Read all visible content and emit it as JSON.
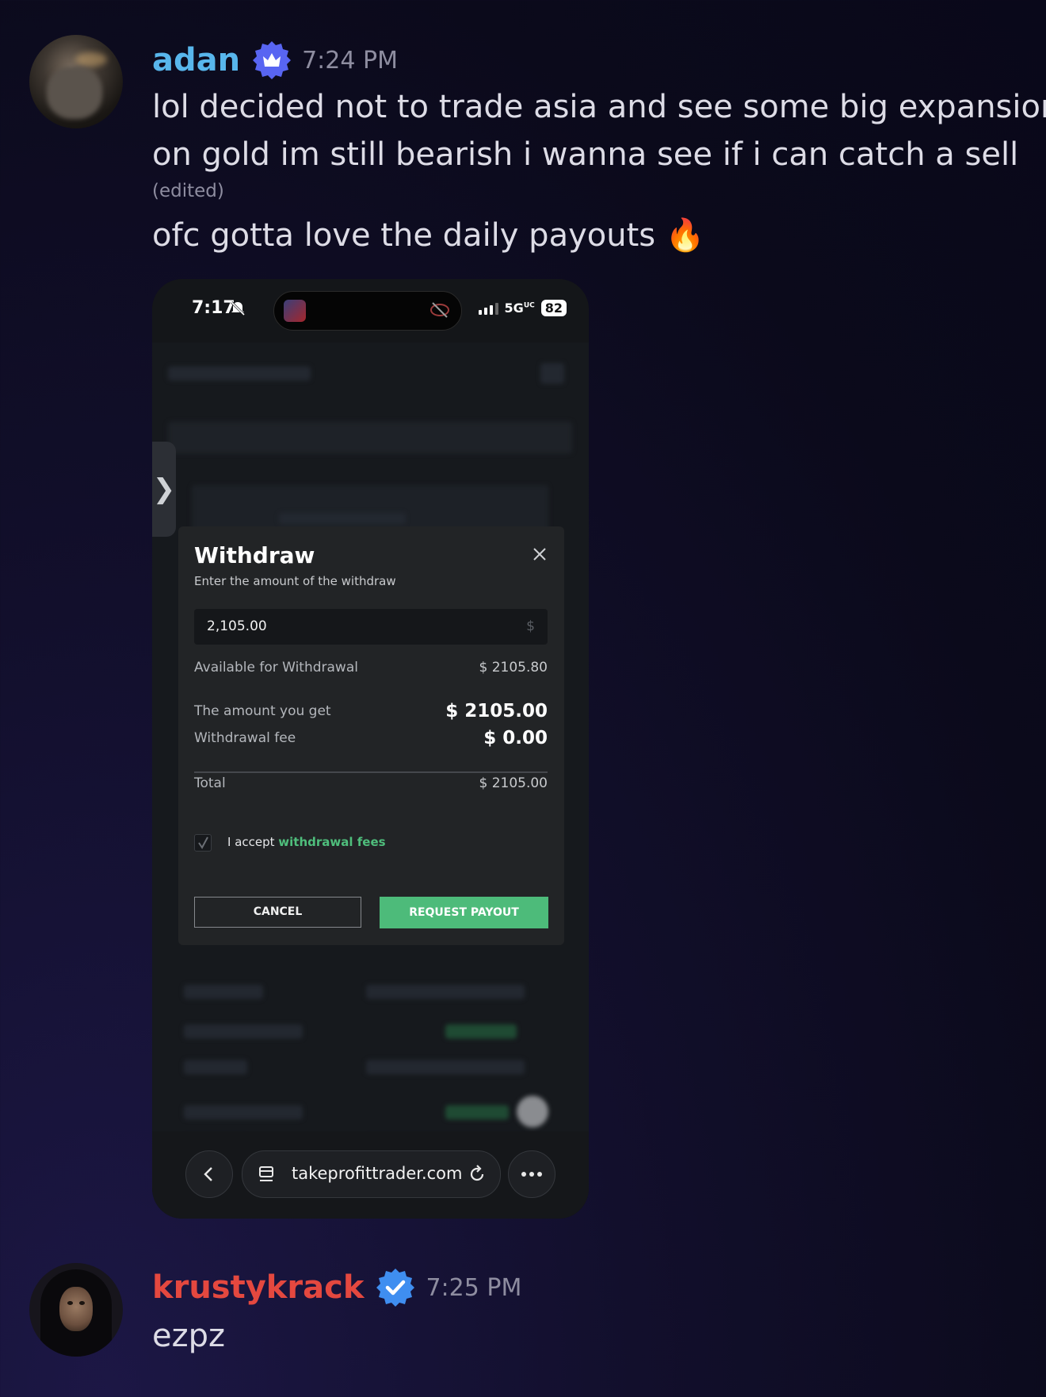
{
  "messages": [
    {
      "username": "adan",
      "time": "7:24 PM",
      "lines": [
        "lol decided not to trade asia and see some big expansion,",
        "on gold im still bearish i wanna see if i can catch a sell"
      ],
      "edited_label": "(edited)",
      "followup": "ofc gotta love the daily payouts 🔥",
      "name_color": "#58b6ec",
      "badge_icon": "crown-badge-icon"
    },
    {
      "username": "krustykrack",
      "time": "7:25 PM",
      "text": "ezpz",
      "name_color": "#e4483f",
      "badge_icon": "verified-check-badge-icon"
    }
  ],
  "screenshot": {
    "status_time": "7:17",
    "network": "5G",
    "network_suffix": "UC",
    "battery": "82",
    "side_tab_glyph": "❯",
    "withdraw": {
      "title": "Withdraw",
      "subtitle": "Enter the amount of the withdraw",
      "amount_value": "2,105.00",
      "currency_symbol": "$",
      "available_label": "Available for Withdrawal",
      "available_value": "$ 2105.80",
      "you_get_label": "The amount you get",
      "you_get_value": "$ 2105.00",
      "fee_label": "Withdrawal fee",
      "fee_value": "$ 0.00",
      "total_label": "Total",
      "total_value": "$ 2105.00",
      "accept_prefix": "I accept",
      "accept_link": "withdrawal fees",
      "cancel_label": "CANCEL",
      "payout_label": "REQUEST PAYOUT",
      "accent_color": "#4dbb7a"
    },
    "browser": {
      "url": "takeprofittrader.com"
    }
  }
}
